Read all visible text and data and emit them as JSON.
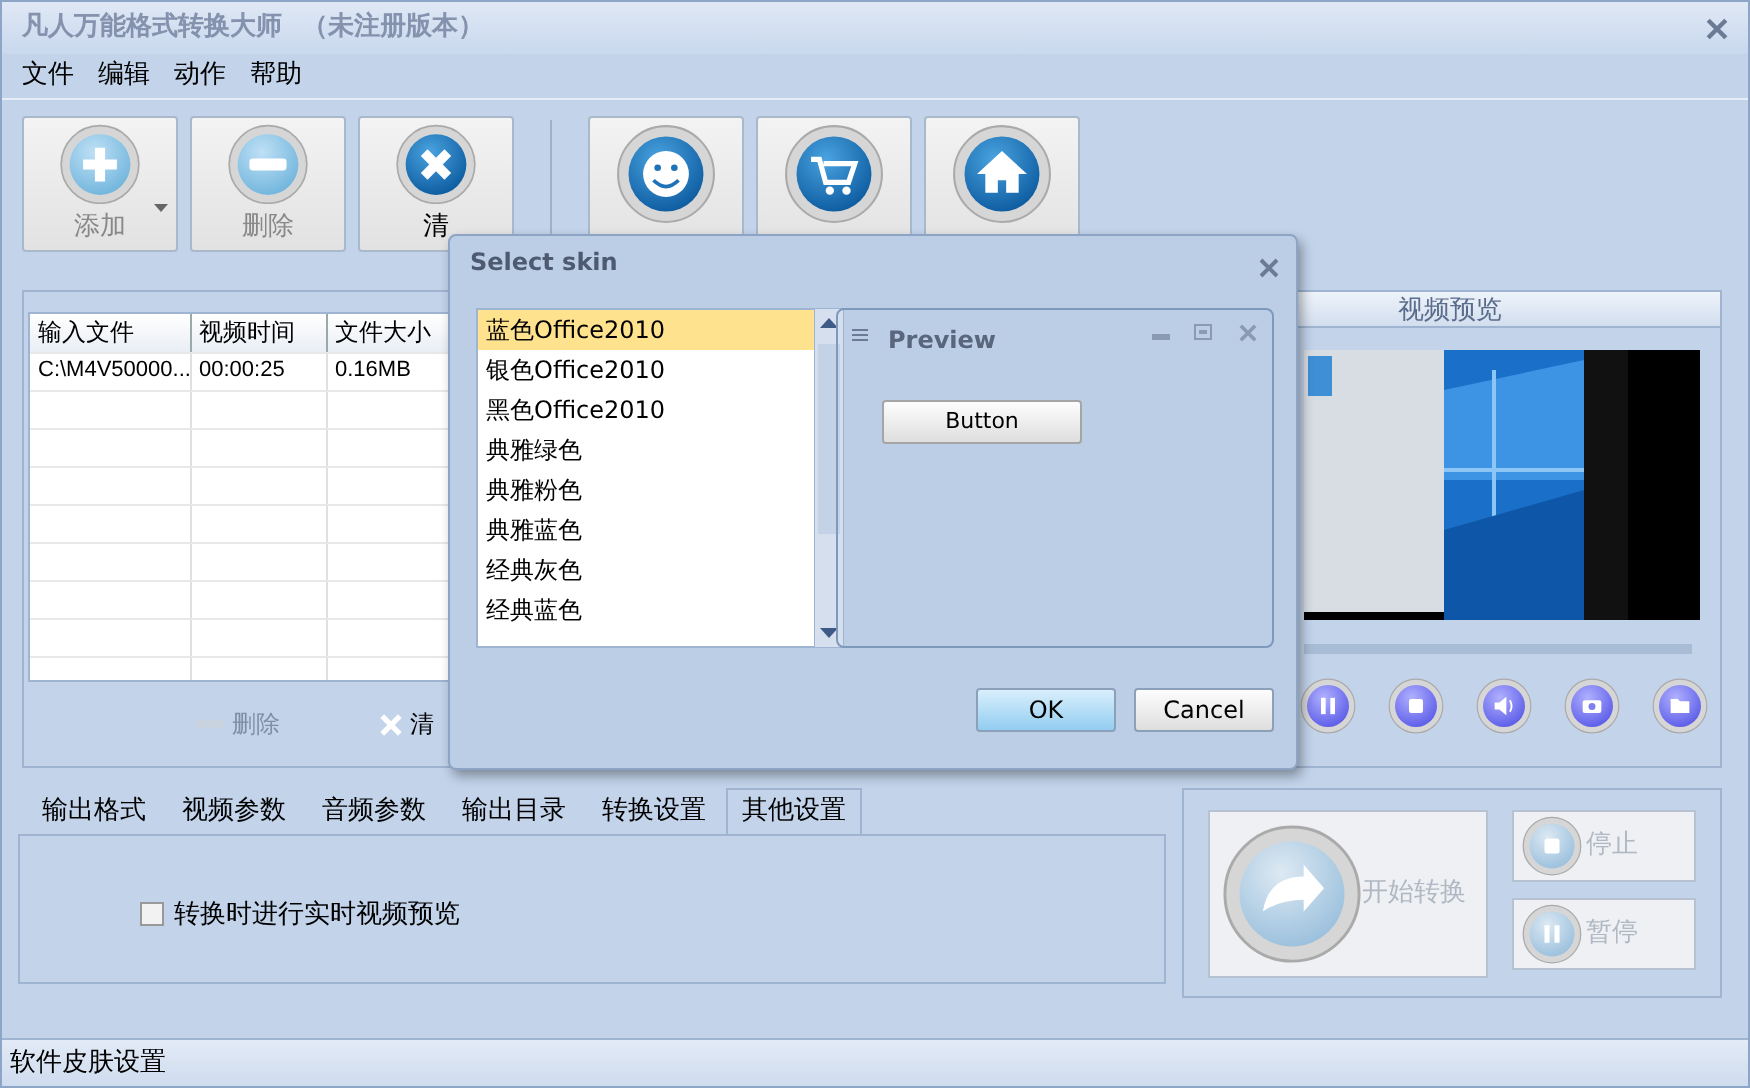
{
  "window": {
    "title": "凡人万能格式转换大师",
    "subtitle": "（未注册版本）"
  },
  "menu": [
    "文件",
    "编辑",
    "动作",
    "帮助"
  ],
  "toolbar": [
    {
      "label": "添加",
      "disabled": true,
      "has_menu": true
    },
    {
      "label": "删除",
      "disabled": true,
      "has_menu": false
    },
    {
      "label": "清",
      "disabled": false,
      "has_menu": false
    },
    {
      "disabled": false,
      "has_menu": false
    },
    {
      "disabled": false,
      "has_menu": false
    },
    {
      "disabled": false,
      "has_menu": false
    }
  ],
  "file_list": {
    "columns": [
      "输入文件",
      "视频时间",
      "文件大小"
    ],
    "rows": [
      [
        "C:\\M4V50000...",
        "00:00:25",
        "0.16MB"
      ]
    ],
    "actions": [
      {
        "label": "删除",
        "disabled": true
      },
      {
        "label": "清",
        "disabled": false
      }
    ]
  },
  "video_preview": {
    "title": "视频预览"
  },
  "tabs": [
    {
      "label": "输出格式",
      "selected": false
    },
    {
      "label": "视频参数",
      "selected": false
    },
    {
      "label": "音频参数",
      "selected": false
    },
    {
      "label": "输出目录",
      "selected": false
    },
    {
      "label": "转换设置",
      "selected": false
    },
    {
      "label": "其他设置",
      "selected": true
    }
  ],
  "options": [
    {
      "label": "转换时进行实时视频预览",
      "checked": false
    }
  ],
  "convert": {
    "start": {
      "label": "开始转换",
      "disabled": true
    },
    "stop": {
      "label": "停止",
      "disabled": true
    },
    "pause": {
      "label": "暂停",
      "disabled": true
    }
  },
  "dialog": {
    "title": "Select skin",
    "skins": [
      {
        "label": "蓝色Office2010",
        "selected": true
      },
      {
        "label": "银色Office2010",
        "selected": false
      },
      {
        "label": "黑色Office2010",
        "selected": false
      },
      {
        "label": "典雅绿色",
        "selected": false
      },
      {
        "label": "典雅粉色",
        "selected": false
      },
      {
        "label": "典雅蓝色",
        "selected": false
      },
      {
        "label": "经典灰色",
        "selected": false
      },
      {
        "label": "经典蓝色",
        "selected": false
      }
    ],
    "preview": {
      "title": "Preview",
      "button": "Button"
    },
    "buttons": [
      {
        "label": "OK",
        "default": true
      },
      {
        "label": "Cancel",
        "default": false
      }
    ]
  },
  "status_bar": "软件皮肤设置"
}
